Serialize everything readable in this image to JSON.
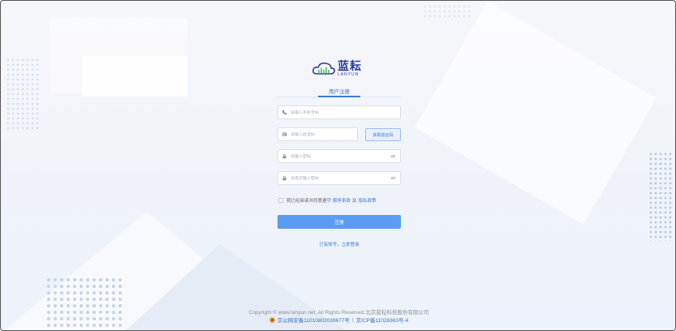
{
  "brand": {
    "name_cn": "蓝耘",
    "name_en": "LANYUN",
    "colors": {
      "primary": "#3a7bd5",
      "button": "#5b9cf3",
      "logo": "#2d3e9c",
      "logo_green": "#4caf50"
    }
  },
  "form": {
    "tab_label": "用户注册",
    "phone": {
      "placeholder": "请输入手机号码",
      "icon": "phone-icon",
      "value": ""
    },
    "code": {
      "placeholder": "请输入验证码",
      "icon": "message-icon",
      "value": ""
    },
    "get_code_label": "获取验证码",
    "password": {
      "placeholder": "请输入密码",
      "icon": "lock-icon",
      "value": ""
    },
    "confirm_password": {
      "placeholder": "请再次输入密码",
      "icon": "lock-icon",
      "value": ""
    },
    "agreement": {
      "prefix": "我已经阅读并同意遵守",
      "terms": "服务条款",
      "and": "及",
      "privacy": "隐私政策",
      "checked": false
    },
    "submit_label": "注册",
    "login_link": "已有账号，立即登录"
  },
  "footer": {
    "copyright": "Copyright © www.lanyun.net, All Rights Reserved.北京蓝耘科技股份有限公司",
    "police_record": "京公网安备11010802039677号",
    "separator": "|",
    "icp_record": "京ICP备11028363号-4"
  }
}
